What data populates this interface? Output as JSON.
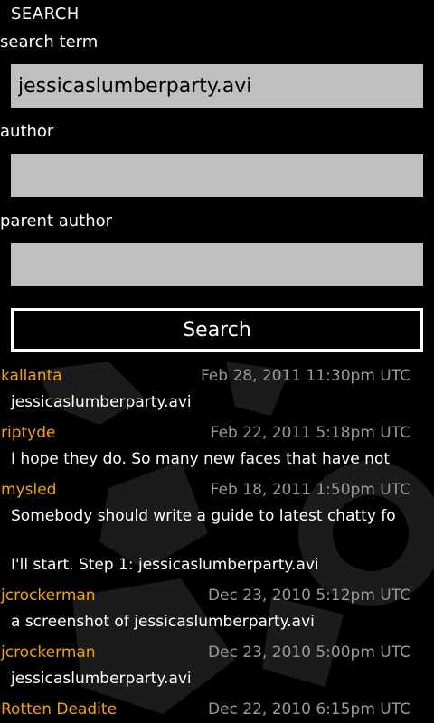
{
  "header": {
    "title": "SEARCH"
  },
  "form": {
    "search_term_label": "search term",
    "search_term_value": "jessicaslumberparty.avi",
    "author_label": "author",
    "author_value": "",
    "parent_author_label": "parent author",
    "parent_author_value": "",
    "search_button": "Search"
  },
  "results": [
    {
      "author": "kallanta",
      "date": "Feb 28, 2011 11:30pm UTC",
      "lines": [
        "jessicaslumberparty.avi"
      ]
    },
    {
      "author": "riptyde",
      "date": "Feb 22, 2011 5:18pm UTC",
      "lines": [
        "I hope they do.  So many new faces that have not"
      ]
    },
    {
      "author": "mysled",
      "date": "Feb 18, 2011 1:50pm UTC",
      "lines": [
        "Somebody should write a guide to latest chatty fo",
        "",
        "I'll start. Step 1: jessicaslumberparty.avi"
      ]
    },
    {
      "author": "jcrockerman",
      "date": "Dec 23, 2010 5:12pm UTC",
      "lines": [
        "a screenshot of jessicaslumberparty.avi"
      ]
    },
    {
      "author": "jcrockerman",
      "date": "Dec 23, 2010 5:00pm UTC",
      "lines": [
        "jessicaslumberparty.avi"
      ]
    },
    {
      "author": "Rotten Deadite",
      "date": "Dec 22, 2010 6:15pm UTC",
      "lines": []
    }
  ]
}
